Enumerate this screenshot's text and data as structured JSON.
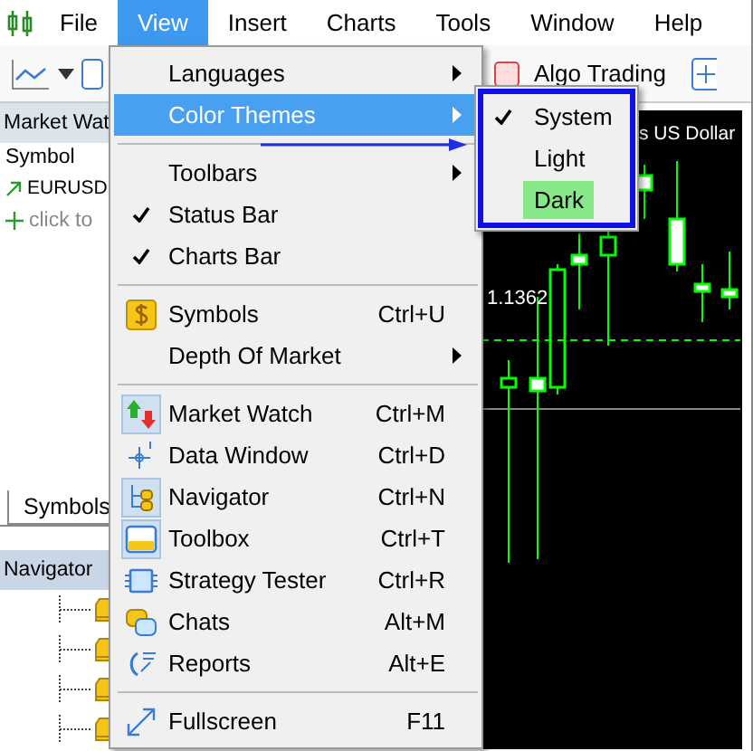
{
  "menubar": [
    {
      "label": "File",
      "selected": false
    },
    {
      "label": "View",
      "selected": true
    },
    {
      "label": "Insert",
      "selected": false
    },
    {
      "label": "Charts",
      "selected": false
    },
    {
      "label": "Tools",
      "selected": false
    },
    {
      "label": "Window",
      "selected": false
    },
    {
      "label": "Help",
      "selected": false
    }
  ],
  "toolbar": {
    "algo_trading": "Algo Trading"
  },
  "market_watch": {
    "title": "Market Wat",
    "column": "Symbol",
    "rows": [
      {
        "symbol": "EURUSD"
      }
    ],
    "add_row": "click to"
  },
  "tabs": [
    {
      "label": "Symbols",
      "selected": true
    }
  ],
  "navigator": {
    "title": "Navigator"
  },
  "chart": {
    "title": "s US Dollar",
    "price_label": "1.1362"
  },
  "view_menu": [
    {
      "kind": "item",
      "label": "Languages",
      "submenu": true,
      "checked": false,
      "selected": false
    },
    {
      "kind": "item",
      "label": "Color Themes",
      "submenu": true,
      "checked": false,
      "selected": true
    },
    {
      "kind": "separator"
    },
    {
      "kind": "item",
      "label": "Toolbars",
      "submenu": true,
      "checked": false,
      "selected": false
    },
    {
      "kind": "item",
      "label": "Status Bar",
      "submenu": false,
      "checked": true,
      "selected": false
    },
    {
      "kind": "item",
      "label": "Charts Bar",
      "submenu": false,
      "checked": true,
      "selected": false
    },
    {
      "kind": "separator"
    },
    {
      "kind": "item",
      "label": "Symbols",
      "shortcut": "Ctrl+U",
      "submenu": false,
      "checked": false,
      "selected": false
    },
    {
      "kind": "item",
      "label": "Depth Of Market",
      "submenu": true,
      "checked": false,
      "selected": false
    },
    {
      "kind": "separator"
    },
    {
      "kind": "item",
      "label": "Market Watch",
      "shortcut": "Ctrl+M",
      "submenu": false,
      "checked": true,
      "selected": false
    },
    {
      "kind": "item",
      "label": "Data Window",
      "shortcut": "Ctrl+D",
      "submenu": false,
      "checked": false,
      "selected": false
    },
    {
      "kind": "item",
      "label": "Navigator",
      "shortcut": "Ctrl+N",
      "submenu": false,
      "checked": true,
      "selected": false
    },
    {
      "kind": "item",
      "label": "Toolbox",
      "shortcut": "Ctrl+T",
      "submenu": false,
      "checked": true,
      "selected": false
    },
    {
      "kind": "item",
      "label": "Strategy Tester",
      "shortcut": "Ctrl+R",
      "submenu": false,
      "checked": false,
      "selected": false
    },
    {
      "kind": "item",
      "label": "Chats",
      "shortcut": "Alt+M",
      "submenu": false,
      "checked": false,
      "selected": false
    },
    {
      "kind": "item",
      "label": "Reports",
      "shortcut": "Alt+E",
      "submenu": false,
      "checked": false,
      "selected": false
    },
    {
      "kind": "separator"
    },
    {
      "kind": "item",
      "label": "Fullscreen",
      "shortcut": "F11",
      "submenu": false,
      "checked": false,
      "selected": false
    }
  ],
  "color_themes_menu": [
    {
      "label": "System",
      "checked": true,
      "highlighted": false
    },
    {
      "label": "Light",
      "checked": false,
      "highlighted": false
    },
    {
      "label": "Dark",
      "checked": false,
      "highlighted": true
    }
  ]
}
